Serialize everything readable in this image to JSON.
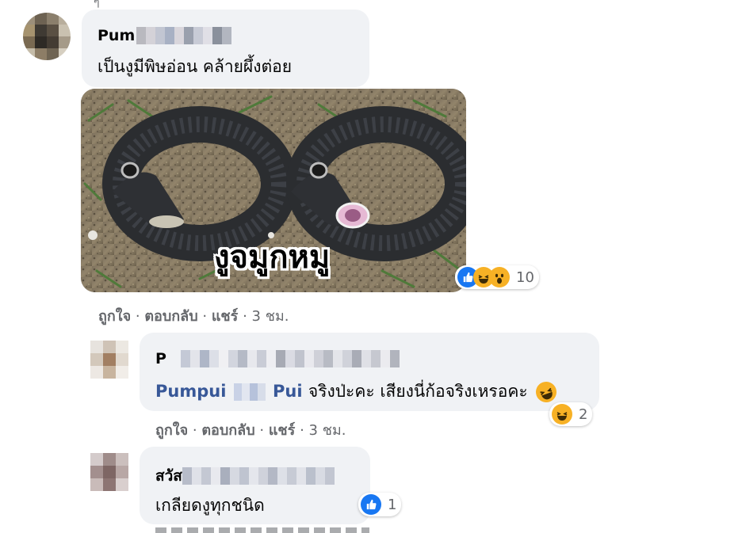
{
  "comment1": {
    "author_visible": "Pum",
    "text": "เป็นงูมีพิษอ่อน คล้ายผึ้งต่อย",
    "image_caption": "งูจมูกหมู",
    "reaction_count": "10",
    "actions": {
      "like": "ถูกใจ",
      "reply": "ตอบกลับ",
      "share": "แชร์",
      "time": "3 ชม."
    }
  },
  "reply1": {
    "author_visible": "P",
    "tag_prefix": "Pumpui",
    "tag_suffix": "Pui",
    "text": " จริงป่ะคะ เสียงนี่ก้อจริงเหรอคะ",
    "reaction_count": "2",
    "actions": {
      "like": "ถูกใจ",
      "reply": "ตอบกลับ",
      "share": "แชร์",
      "time": "3 ชม."
    }
  },
  "reply2": {
    "author_visible": "สวัส",
    "text": "เกลียดงูทุกชนิด",
    "reaction_count": "1"
  },
  "separator": "·",
  "colors": {
    "bubble": "#f0f2f5",
    "meta_text": "#65676b",
    "like_blue": "#1877f2",
    "haha_yellow": "#f7b125"
  }
}
